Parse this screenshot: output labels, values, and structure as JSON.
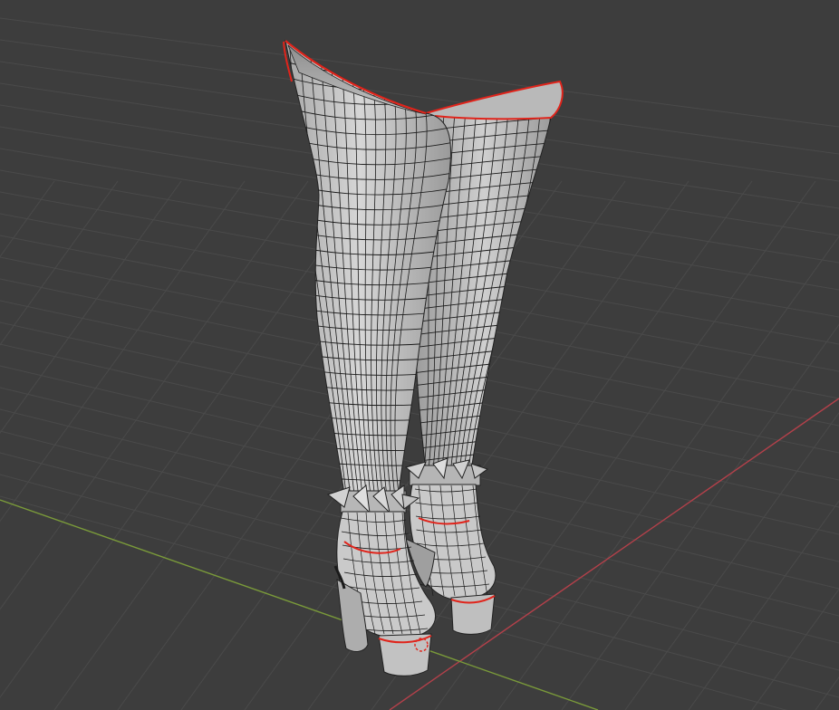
{
  "viewport": {
    "mode": "edit-mode-wireframe-overlay",
    "background_color": "#3d3d3d",
    "grid_color": "#4a4a4a",
    "x_axis_color": "#b3404a",
    "y_axis_color": "#7a9a3a"
  },
  "mesh": {
    "name": "thigh-high-platform-boots",
    "surface_color": "#c8c8c8",
    "wire_color": "#1a1a1a",
    "seam_color": "#e0241b"
  }
}
